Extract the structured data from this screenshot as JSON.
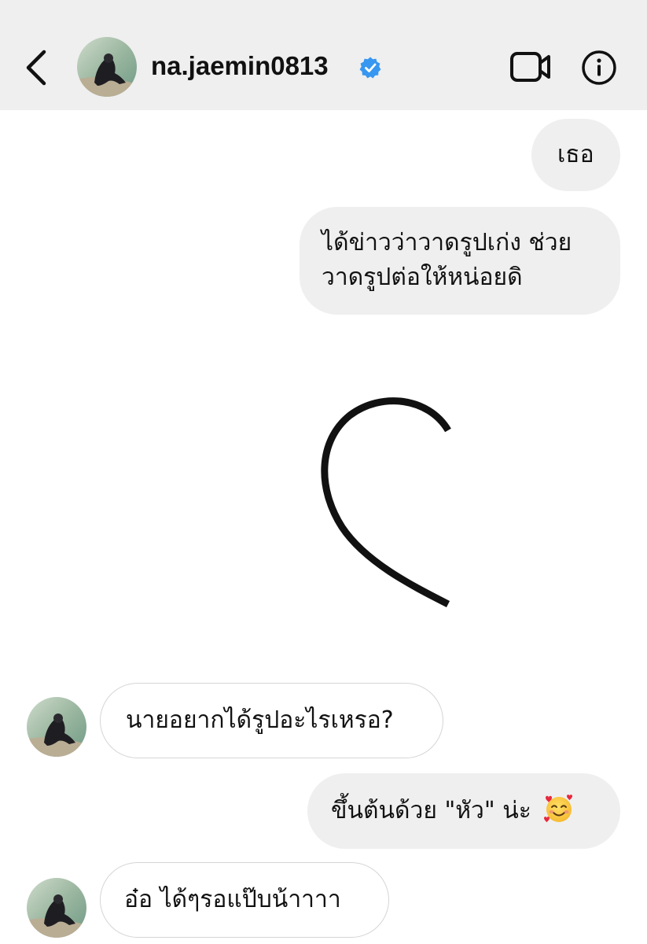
{
  "header": {
    "username": "na.jaemin0813",
    "verified": true,
    "back_icon": "chevron-left-icon",
    "video_icon": "video-camera-icon",
    "info_icon": "info-icon"
  },
  "messages": [
    {
      "sender": "me",
      "text": "เธอ"
    },
    {
      "sender": "me",
      "lines": [
        "ได้ข่าวว่าวาดรูปเก่ง ช่วย",
        "วาดรูปต่อให้หน่อยดิ"
      ]
    },
    {
      "sender": "me",
      "type": "drawing",
      "description_icon": "half-heart-drawing"
    },
    {
      "sender": "them",
      "text": "นายอยากได้รูปอะไรเหรอ?"
    },
    {
      "sender": "me",
      "text": "ขึ้นต้นด้วย \"หัว\" น่ะ",
      "emoji": "smiling-face-with-hearts"
    },
    {
      "sender": "them",
      "text": "อ๋อ ได้ๆรอแป๊บน้าาาา"
    }
  ],
  "colors": {
    "header_bg": "#efefef",
    "sent_bubble": "#efefef",
    "received_border": "#d5d5d5",
    "verified_blue": "#3897f0"
  }
}
